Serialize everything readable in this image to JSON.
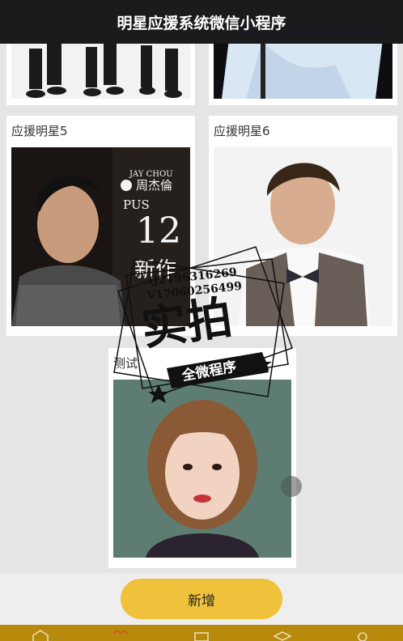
{
  "nav": {
    "title": "明星应援系统微信小程序"
  },
  "cards": [
    {
      "label": "应援明星5",
      "poster_lines": [
        "JAY CHOU",
        "周杰倫",
        "PUS",
        "12",
        "新作"
      ]
    },
    {
      "label": "应援明星6"
    },
    {
      "label": "测试"
    }
  ],
  "watermark": {
    "qq": "Q2196316269",
    "vx": "V17060256499",
    "main": "实拍",
    "sub": "全微程序"
  },
  "actions": {
    "add_label": "新增"
  },
  "colors": {
    "nav": "#1b1b1d",
    "button": "#f0c23b",
    "tabbar": "#b88a0b"
  },
  "tabbar_icons": [
    "home-icon",
    "heart-icon",
    "calendar-icon",
    "graduation-icon",
    "user-icon"
  ]
}
